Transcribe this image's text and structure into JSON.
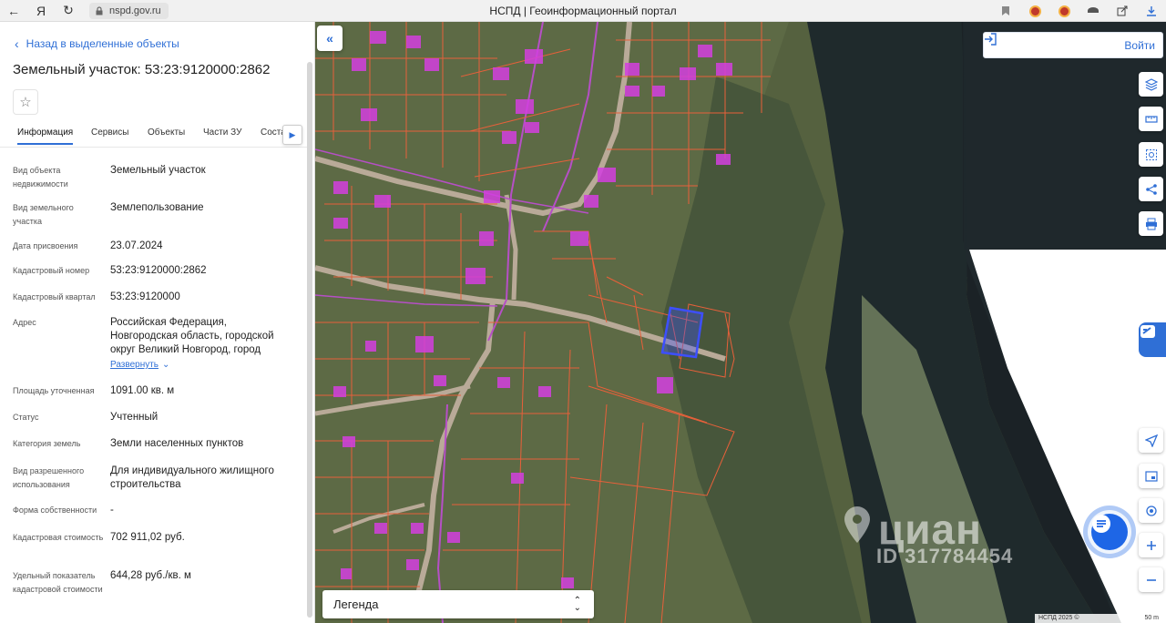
{
  "browser": {
    "url": "nspd.gov.ru",
    "title": "НСПД | Геоинформационный портал"
  },
  "panel": {
    "back_label": "Назад в выделенные объекты",
    "title": "Земельный участок: 53:23:9120000:2862",
    "tabs": [
      {
        "label": "Информация",
        "active": true
      },
      {
        "label": "Сервисы"
      },
      {
        "label": "Объекты"
      },
      {
        "label": "Части ЗУ"
      },
      {
        "label": "Состав"
      }
    ],
    "fields": [
      {
        "label": "Вид объекта недвижимости",
        "value": "Земельный участок"
      },
      {
        "label": "Вид земельного участка",
        "value": "Землепользование"
      },
      {
        "label": "Дата присвоения",
        "value": "23.07.2024"
      },
      {
        "label": "Кадастровый номер",
        "value": "53:23:9120000:2862"
      },
      {
        "label": "Кадастровый квартал",
        "value": "53:23:9120000"
      },
      {
        "label": "Адрес",
        "value": "Российская Федерация, Новгородская область, городской округ Великий Новгород, город"
      },
      {
        "label": "Площадь уточненная",
        "value": "1091.00 кв. м"
      },
      {
        "label": "Статус",
        "value": "Учтенный"
      },
      {
        "label": "Категория земель",
        "value": "Земли населенных пунктов"
      },
      {
        "label": "Вид разрешенного использования",
        "value": "Для индивидуального жилищного строительства"
      },
      {
        "label": "Форма собственности",
        "value": "-"
      },
      {
        "label": "Кадастровая стоимость",
        "value": "702 911,02 руб."
      },
      {
        "label": "Удельный показатель кадастровой стоимости",
        "value": "644,28 руб./кв. м"
      }
    ],
    "expand_label": "Развернуть"
  },
  "map": {
    "login_label": "Войти",
    "legend_label": "Легенда",
    "watermark_brand": "циан",
    "watermark_id": "ID 317784454",
    "scale_copyright": "НСПД 2025 ©",
    "scale_label": "50 m"
  },
  "colors": {
    "accent": "#2f6fd6",
    "parcel_border": "#e8603a",
    "selected_parcel": "#3d4fff",
    "building": "#d43fe0"
  }
}
